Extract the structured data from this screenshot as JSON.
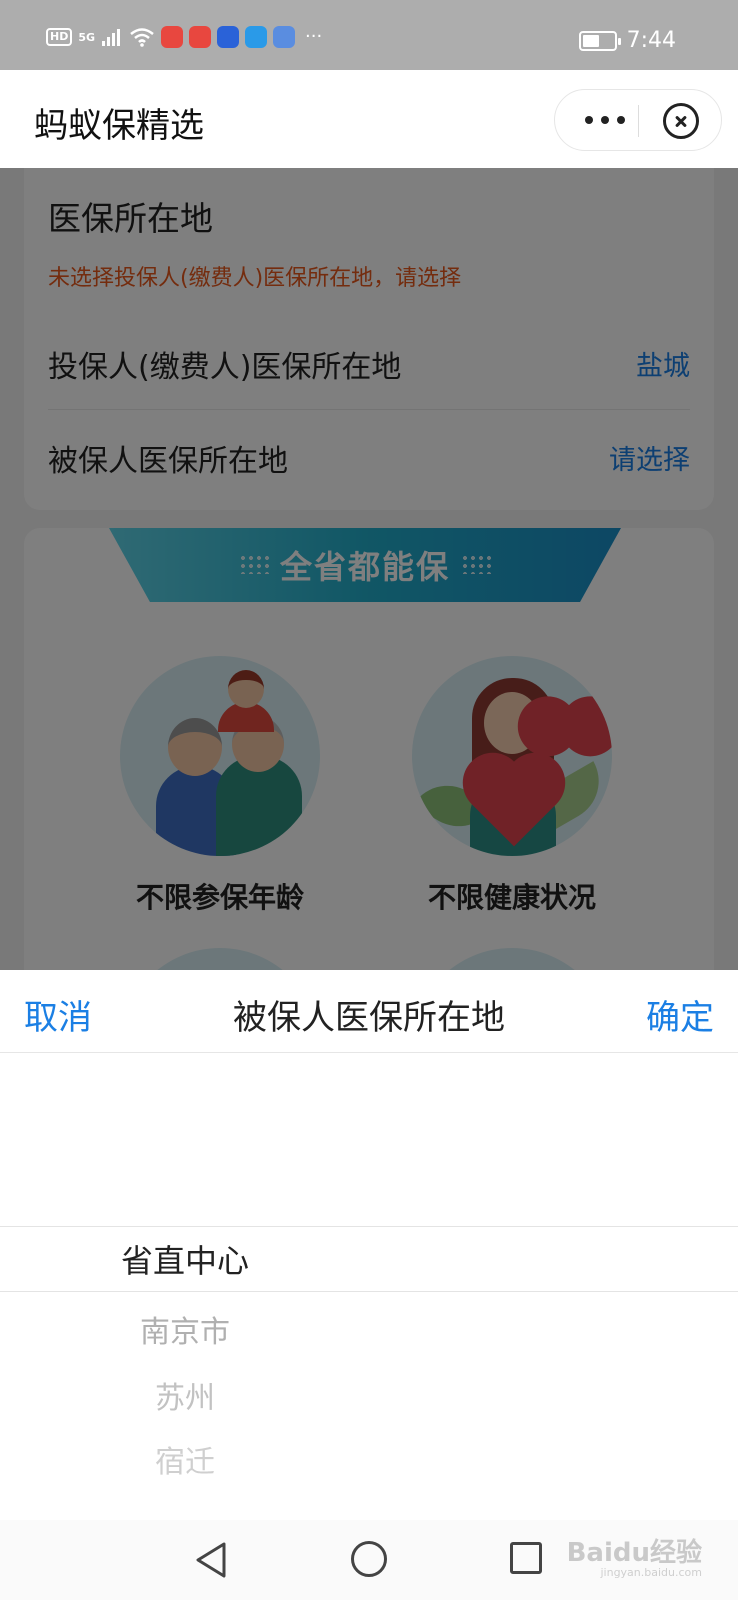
{
  "status_bar": {
    "hd": "HD",
    "network": "5G",
    "time": "7:44",
    "dots": "···",
    "battery_level": 0.6,
    "app_icon_colors": [
      "#e8473f",
      "#e8473f",
      "#2a62d8",
      "#2a9ae8",
      "#5a8de0"
    ]
  },
  "title_bar": {
    "title": "蚂蚁保精选",
    "more_icon": "more-dots-icon",
    "close_icon": "close-circle-icon"
  },
  "location_section": {
    "title": "医保所在地",
    "warning": "未选择投保人(缴费人)医保所在地，请选择",
    "rows": [
      {
        "label": "投保人(缴费人)医保所在地",
        "value": "盐城"
      },
      {
        "label": "被保人医保所在地",
        "value": "请选择"
      }
    ]
  },
  "features": {
    "banner": "全省都能保",
    "items": [
      {
        "label": "不限参保年龄",
        "icon": "family-illustration"
      },
      {
        "label": "不限健康状况",
        "icon": "heart-woman-illustration"
      }
    ]
  },
  "picker": {
    "cancel": "取消",
    "title": "被保人医保所在地",
    "confirm": "确定",
    "selected": "省直中心",
    "options": [
      "南京市",
      "苏州",
      "宿迁"
    ]
  },
  "watermark": {
    "main": "Baidu经验",
    "sub": "jingyan.baidu.com"
  },
  "colors": {
    "accent": "#1b7fe4",
    "warning": "#e8581c",
    "banner": "#22aecb"
  }
}
